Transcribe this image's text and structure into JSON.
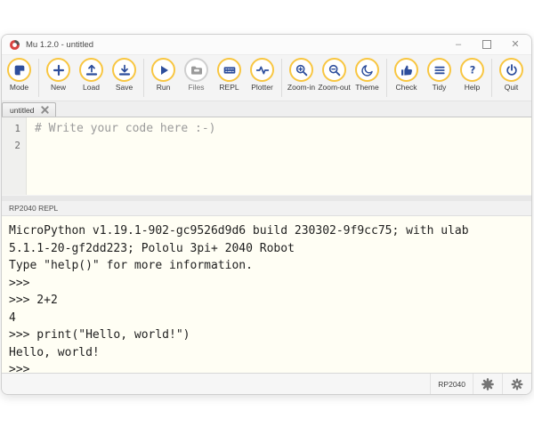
{
  "colors": {
    "accent_yellow": "#f8c641",
    "icon_blue": "#2d4e9c",
    "editor_bg": "#fffef4",
    "logo_red": "#d94341"
  },
  "window": {
    "title": "Mu 1.2.0 - untitled",
    "minimize_glyph": "–",
    "close_glyph": "✕"
  },
  "toolbar": {
    "buttons": [
      {
        "label": "Mode",
        "icon": "mode-icon",
        "enabled": true,
        "sep_before": false
      },
      {
        "label": "New",
        "icon": "new-icon",
        "enabled": true,
        "sep_before": true
      },
      {
        "label": "Load",
        "icon": "load-icon",
        "enabled": true,
        "sep_before": false
      },
      {
        "label": "Save",
        "icon": "save-icon",
        "enabled": true,
        "sep_before": false
      },
      {
        "label": "Run",
        "icon": "run-icon",
        "enabled": true,
        "sep_before": true
      },
      {
        "label": "Files",
        "icon": "files-icon",
        "enabled": false,
        "sep_before": false
      },
      {
        "label": "REPL",
        "icon": "repl-icon",
        "enabled": true,
        "sep_before": false
      },
      {
        "label": "Plotter",
        "icon": "plotter-icon",
        "enabled": true,
        "sep_before": false
      },
      {
        "label": "Zoom-in",
        "icon": "zoom-in-icon",
        "enabled": true,
        "sep_before": true
      },
      {
        "label": "Zoom-out",
        "icon": "zoom-out-icon",
        "enabled": true,
        "sep_before": false
      },
      {
        "label": "Theme",
        "icon": "theme-icon",
        "enabled": true,
        "sep_before": false
      },
      {
        "label": "Check",
        "icon": "check-icon",
        "enabled": true,
        "sep_before": true
      },
      {
        "label": "Tidy",
        "icon": "tidy-icon",
        "enabled": true,
        "sep_before": false
      },
      {
        "label": "Help",
        "icon": "help-icon",
        "enabled": true,
        "sep_before": false
      },
      {
        "label": "Quit",
        "icon": "quit-icon",
        "enabled": true,
        "sep_before": true
      }
    ]
  },
  "tabs": [
    {
      "label": "untitled",
      "active": true
    }
  ],
  "editor": {
    "lines": [
      {
        "number": "1",
        "text": "# Write your code here :-)",
        "type": "comment"
      },
      {
        "number": "2",
        "text": "",
        "type": "code"
      }
    ]
  },
  "repl": {
    "header": "RP2040 REPL",
    "lines": [
      "MicroPython v1.19.1-902-gc9526d9d6 build 230302-9f9cc75; with ulab",
      "5.1.1-20-gf2dd223; Pololu 3pi+ 2040 Robot",
      "Type \"help()\" for more information.",
      ">>> ",
      ">>> 2+2",
      "4",
      ">>> print(\"Hello, world!\")",
      "Hello, world!",
      ">>> "
    ]
  },
  "statusbar": {
    "mode_label": "RP2040",
    "icons": [
      "device-gear-icon",
      "admin-gear-icon"
    ]
  }
}
